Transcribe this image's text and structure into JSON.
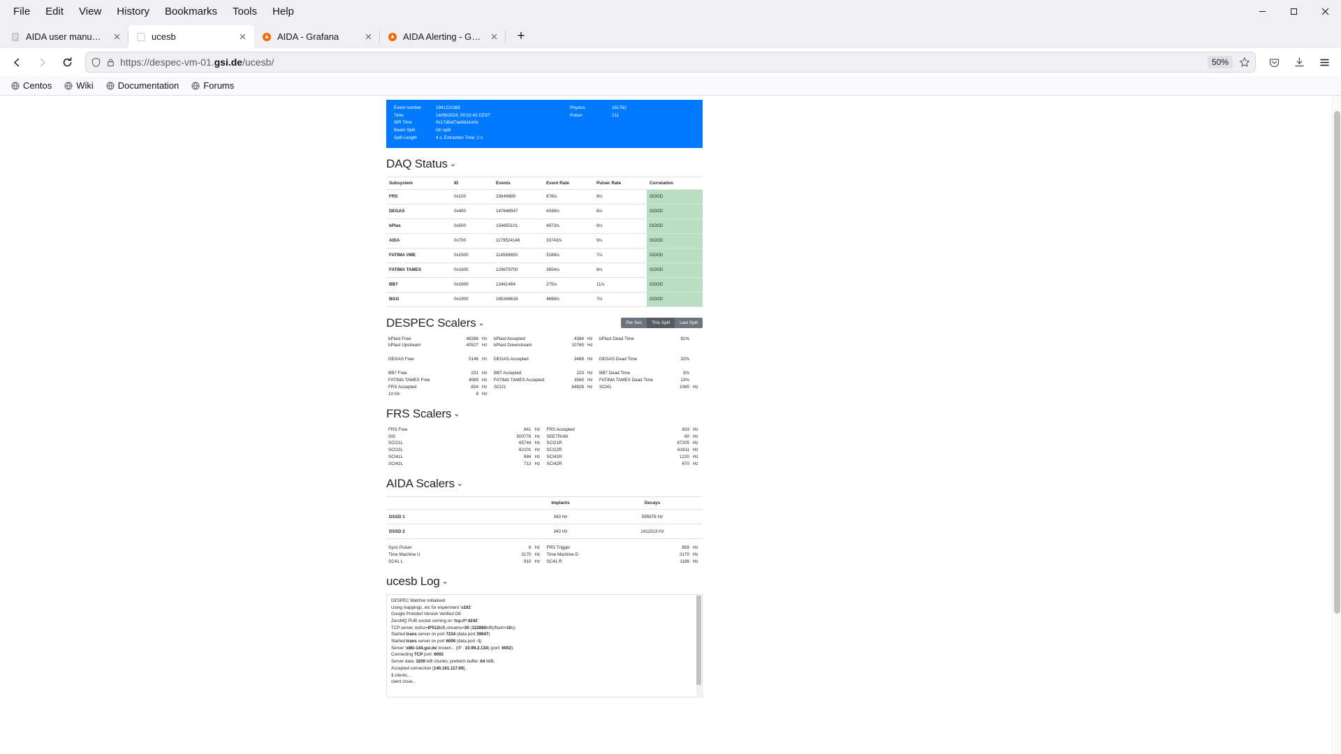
{
  "browser": {
    "menus": [
      "File",
      "Edit",
      "View",
      "History",
      "Bookmarks",
      "Tools",
      "Help"
    ],
    "window_controls": {
      "minimize": "minimize-icon",
      "maximize": "maximize-icon",
      "close": "close-icon"
    },
    "tabs": [
      {
        "title": "AIDA user manual - aida_man",
        "active": false,
        "favicon": "doc-icon"
      },
      {
        "title": "ucesb",
        "active": true,
        "favicon": "blank-icon"
      },
      {
        "title": "AIDA - Grafana",
        "active": false,
        "favicon": "grafana-icon"
      },
      {
        "title": "AIDA Alerting - Grafana",
        "active": false,
        "favicon": "grafana-icon"
      }
    ],
    "new_tab_label": "+",
    "url_prefix": "https://despec-vm-01.",
    "url_host": "gsi.de",
    "url_suffix": "/ucesb/",
    "zoom_level": "50%",
    "bookmarks": [
      "Centos",
      "Wiki",
      "Documentation",
      "Forums"
    ]
  },
  "banner": {
    "left_keys": [
      "Event number",
      "Time",
      "WR Time",
      "Beam Spill",
      "Spill Length"
    ],
    "left_values": [
      "1941221385",
      "14/06/2024, 00:02:43 CEST",
      "0x17d8af7ae8da1e0e",
      "On spill",
      "4 s, Extraction Time: 2 s"
    ],
    "right_keys": [
      "Physics",
      "Pulser"
    ],
    "right_values": [
      "161762",
      "211"
    ],
    "color": "#007bff"
  },
  "daq": {
    "title": "DAQ Status",
    "caret": "⌄",
    "columns": [
      "Subsystem",
      "ID",
      "Events",
      "Event Rate",
      "Pulser Rate",
      "Correlation"
    ],
    "rows": [
      {
        "subsystem": "FRS",
        "id": "0x100",
        "events": "33649889",
        "event_rate": "876/s",
        "pulser_rate": "9/s",
        "correlation": "GOOD"
      },
      {
        "subsystem": "DEGAS",
        "id": "0x400",
        "events": "147648547",
        "event_rate": "4338/s",
        "pulser_rate": "8/s",
        "correlation": "GOOD"
      },
      {
        "subsystem": "bPlas",
        "id": "0x500",
        "events": "154855101",
        "event_rate": "4973/s",
        "pulser_rate": "9/s",
        "correlation": "GOOD"
      },
      {
        "subsystem": "AIDA",
        "id": "0x700",
        "events": "1179524146",
        "event_rate": "33743/s",
        "pulser_rate": "9/s",
        "correlation": "GOOD"
      },
      {
        "subsystem": "FATIMA VME",
        "id": "0x1500",
        "events": "114569655",
        "event_rate": "3188/s",
        "pulser_rate": "7/s",
        "correlation": "GOOD"
      },
      {
        "subsystem": "FATIMA TAMEX",
        "id": "0x1600",
        "events": "129679700",
        "event_rate": "3654/s",
        "pulser_rate": "8/s",
        "correlation": "GOOD"
      },
      {
        "subsystem": "BB7",
        "id": "0x1800",
        "events": "13461464",
        "event_rate": "275/s",
        "pulser_rate": "11/s",
        "correlation": "GOOD"
      },
      {
        "subsystem": "BGO",
        "id": "0x1900",
        "events": "165348616",
        "event_rate": "4698/s",
        "pulser_rate": "7/s",
        "correlation": "GOOD"
      }
    ],
    "good_color": "#b8dfc2"
  },
  "despec": {
    "title": "DESPEC Scalers",
    "caret": "⌄",
    "range_tabs": [
      {
        "label": "Per Sec",
        "selected": false
      },
      {
        "label": "This Spill",
        "selected": true
      },
      {
        "label": "Last Spill",
        "selected": false
      }
    ],
    "col1": [
      {
        "label": "bPlast Free",
        "value": "48288",
        "unit": "Hz"
      },
      {
        "label": "bPlast Upstream",
        "value": "40527",
        "unit": "Hz"
      },
      {
        "label": "",
        "value": "",
        "unit": ""
      },
      {
        "label": "DEGAS Free",
        "value": "5146",
        "unit": "Hz"
      },
      {
        "label": "",
        "value": "",
        "unit": ""
      },
      {
        "label": "BB7 Free",
        "value": "231",
        "unit": "Hz"
      },
      {
        "label": "FATIMA TAMEX Free",
        "value": "4089",
        "unit": "Hz"
      },
      {
        "label": "FRS Accepted",
        "value": "824",
        "unit": "Hz"
      },
      {
        "label": "10 Hz",
        "value": "8",
        "unit": "Hz"
      }
    ],
    "col2": [
      {
        "label": "bPlast Accepted",
        "value": "4384",
        "unit": "Hz"
      },
      {
        "label": "bPlast Downstream",
        "value": "10765",
        "unit": "Hz"
      },
      {
        "label": "",
        "value": "",
        "unit": ""
      },
      {
        "label": "DEGAS Accepted",
        "value": "3488",
        "unit": "Hz"
      },
      {
        "label": "",
        "value": "",
        "unit": ""
      },
      {
        "label": "BB7 Accepted",
        "value": "223",
        "unit": "Hz"
      },
      {
        "label": "FATIMA TAMEX Accepted",
        "value": "3565",
        "unit": "Hz"
      },
      {
        "label": "SCI21",
        "value": "64928",
        "unit": "Hz"
      },
      {
        "label": "",
        "value": "",
        "unit": ""
      }
    ],
    "col3": [
      {
        "label": "bPlast Dead Time",
        "value": "91%",
        "unit": ""
      },
      {
        "label": "",
        "value": "",
        "unit": ""
      },
      {
        "label": "",
        "value": "",
        "unit": ""
      },
      {
        "label": "DEGAS Dead Time",
        "value": "32%",
        "unit": ""
      },
      {
        "label": "",
        "value": "",
        "unit": ""
      },
      {
        "label": "BB7 Dead Time",
        "value": "3%",
        "unit": ""
      },
      {
        "label": "FATIMA TAMEX Dead Time",
        "value": "13%",
        "unit": ""
      },
      {
        "label": "SCI41",
        "value": "1065",
        "unit": "Hz"
      },
      {
        "label": "",
        "value": "",
        "unit": ""
      }
    ]
  },
  "frs": {
    "title": "FRS Scalers",
    "caret": "⌄",
    "col1": [
      {
        "label": "FRS Free",
        "value": "841",
        "unit": "Hz"
      },
      {
        "label": "SIS",
        "value": "500778",
        "unit": "Hz"
      },
      {
        "label": "SCI21L",
        "value": "65744",
        "unit": "Hz"
      },
      {
        "label": "SCI22L",
        "value": "62101",
        "unit": "Hz"
      },
      {
        "label": "SCI41L",
        "value": "884",
        "unit": "Hz"
      },
      {
        "label": "SCI42L",
        "value": "713",
        "unit": "Hz"
      }
    ],
    "col2": [
      {
        "label": "FRS Accepted",
        "value": "833",
        "unit": "Hz"
      },
      {
        "label": "SEETRAM",
        "value": "60",
        "unit": "Hz"
      },
      {
        "label": "SCI21R",
        "value": "67205",
        "unit": "Hz"
      },
      {
        "label": "SCI22R",
        "value": "61611",
        "unit": "Hz"
      },
      {
        "label": "SCI41R",
        "value": "1220",
        "unit": "Hz"
      },
      {
        "label": "SCI42R",
        "value": "670",
        "unit": "Hz"
      }
    ]
  },
  "aida": {
    "title": "AIDA Scalers",
    "caret": "⌄",
    "columns": [
      "",
      "Implants",
      "Decays"
    ],
    "rows": [
      {
        "name": "DSSD 1",
        "implants": "343 Hz",
        "decays": "595878 Hz"
      },
      {
        "name": "DSSD 2",
        "implants": "343 Hz",
        "decays": "1411513 Hz"
      }
    ],
    "col1": [
      {
        "label": "Sync Pulser",
        "value": "8",
        "unit": "Hz"
      },
      {
        "label": "Time Machine U",
        "value": "3170",
        "unit": "Hz"
      },
      {
        "label": "SC41 L",
        "value": "910",
        "unit": "Hz"
      }
    ],
    "col2": [
      {
        "label": "FRS Trigger",
        "value": "859",
        "unit": "Hz"
      },
      {
        "label": "Time Machine D",
        "value": "3170",
        "unit": "Hz"
      },
      {
        "label": "SC41 R",
        "value": "1188",
        "unit": "Hz"
      }
    ]
  },
  "log": {
    "title": "ucesb Log",
    "caret": "⌄",
    "lines": [
      "DESPEC Watcher initialised",
      "Using mappings, etc for experiment '<b>s181</b>'",
      "Google Protobuf Version Verified OK",
      "ZeroMQ PUB socket running on '<b>tcp://*:4242</b>'",
      "TCP server, bufsz=<b>8*512</b>kiB,streams=<b>30</b> (<b>122880</b>kiB)/flush=<b>10</b>s);",
      "Started <b>trans</b> server on port <b>7234</b> (data port <b>39947</b>)",
      "Started <b>trans</b> server on port <b>6000</b> (data port <b>-1</b>)",
      "Server '<b>x86i-144.gsi.de</b>' known... (IP : <b>10.99.2.134</b>) (port: <b>6002</b>).",
      "Connecting <b>TCP</b> port: <b>6002</b>",
      "Server data: <b>3200</b> kiB chunks; prefetch buffer: <b>64</b> MiB.",
      "Accepted connection [<b>140.181.117.69</b>]..",
      "<b>1</b> clients...",
      "client close..."
    ]
  }
}
